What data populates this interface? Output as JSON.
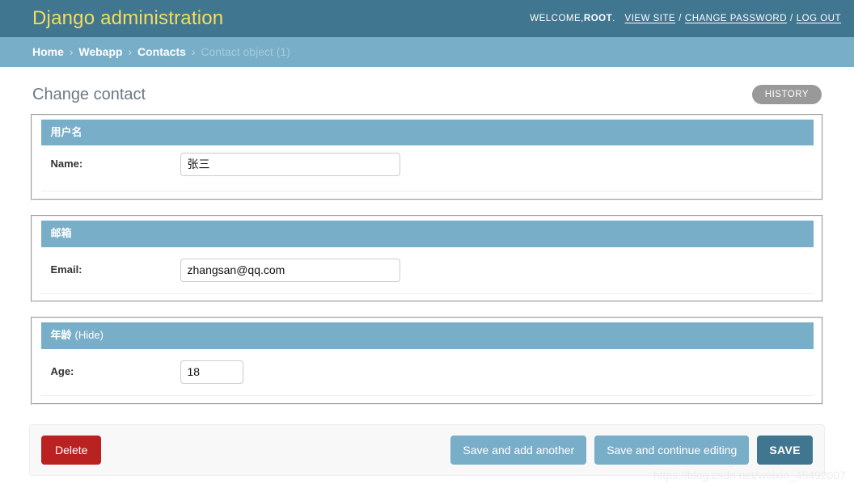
{
  "header": {
    "site_name": "Django administration",
    "welcome_text": "WELCOME, ",
    "username": "ROOT",
    "after_username": ".",
    "links": [
      {
        "label": "VIEW SITE"
      },
      {
        "label": "CHANGE PASSWORD"
      },
      {
        "label": "LOG OUT"
      }
    ],
    "separator": "/"
  },
  "breadcrumbs": {
    "separator": "›",
    "items": [
      {
        "label": "Home",
        "current": false
      },
      {
        "label": "Webapp",
        "current": false
      },
      {
        "label": "Contacts",
        "current": false
      },
      {
        "label": "Contact object (1)",
        "current": true
      }
    ]
  },
  "content": {
    "page_title": "Change contact",
    "history_label": "HISTORY"
  },
  "fieldsets": [
    {
      "legend": "用户名",
      "collapse_toggle": "",
      "rows": [
        {
          "label": "Name:",
          "input_type": "text",
          "value": "张三",
          "placeholder": "",
          "size_class": "vTextField"
        }
      ]
    },
    {
      "legend": "邮箱",
      "collapse_toggle": "",
      "rows": [
        {
          "label": "Email:",
          "input_type": "email",
          "value": "zhangsan@qq.com",
          "placeholder": "",
          "size_class": "vTextField"
        }
      ]
    },
    {
      "legend": "年龄",
      "collapse_toggle": "(Hide)",
      "rows": [
        {
          "label": "Age:",
          "input_type": "text",
          "value": "18",
          "placeholder": "",
          "size_class": "vIntegerField"
        }
      ]
    }
  ],
  "submit_row": {
    "delete_label": "Delete",
    "save_add_another_label": "Save and add another",
    "save_continue_label": "Save and continue editing",
    "save_label": "SAVE"
  },
  "watermark": "https://blog.csdn.net/weixin_45492007",
  "colors": {
    "header_bg": "#417690",
    "header_title": "#f5dd5d",
    "breadcrumb_bg": "#79aec8",
    "module_header_bg": "#79aec8",
    "delete_btn": "#ba2121",
    "save_btn": "#417690",
    "secondary_btn": "#79aec8",
    "history_btn": "#999999"
  }
}
